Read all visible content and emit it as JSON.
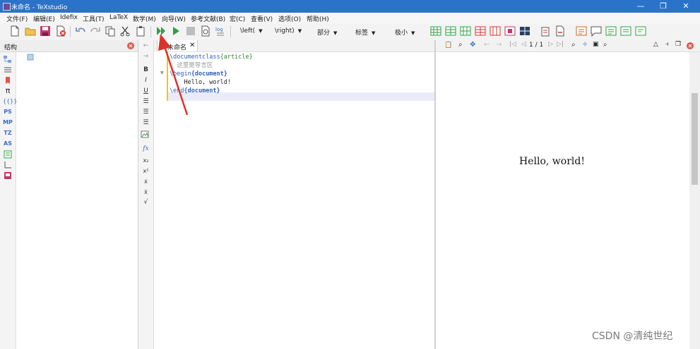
{
  "window": {
    "title": "未命名 - TeXstudio",
    "minimize": "—",
    "restore": "❐",
    "close": "✕"
  },
  "menu": [
    "文件(F)",
    "编辑(E)",
    "Idefix",
    "工具(T)",
    "LaTeX",
    "数学(M)",
    "向导(W)",
    "参考文献(B)",
    "宏(C)",
    "查看(V)",
    "选项(O)",
    "帮助(H)"
  ],
  "toolbar": {
    "left_delim": "\\left(",
    "right_delim": "\\right)",
    "section": "部分",
    "label": "标签",
    "size": "极小"
  },
  "structure": {
    "title": "结构"
  },
  "left_panel_icons": [
    "PS",
    "MP",
    "TZ",
    "AS"
  ],
  "symbols": [
    "B",
    "I",
    "U",
    "fx",
    "x₂",
    "x²",
    "ẋ",
    "ẍ",
    "√"
  ],
  "editor": {
    "tab_label": "未命名",
    "tab_close": "✕",
    "lines": [
      {
        "a": "\\documentclass",
        "b": "{article}",
        "c": ""
      },
      {
        "a": "  这里是导言区",
        "b": "",
        "c": ""
      },
      {
        "a": "\\begin",
        "b": "{document}",
        "c": ""
      },
      {
        "a": "    Hello, world!",
        "b": "",
        "c": ""
      },
      {
        "a": "\\end",
        "b": "{document}",
        "c": ""
      }
    ]
  },
  "preview": {
    "page_indicator": "1 / 1",
    "content": "Hello, world!"
  },
  "watermark": "CSDN @清纯世纪",
  "colors": {
    "titlebar": "#2b73c8",
    "accent_red": "#d9342b",
    "keyword_blue": "#2f5fb8"
  }
}
